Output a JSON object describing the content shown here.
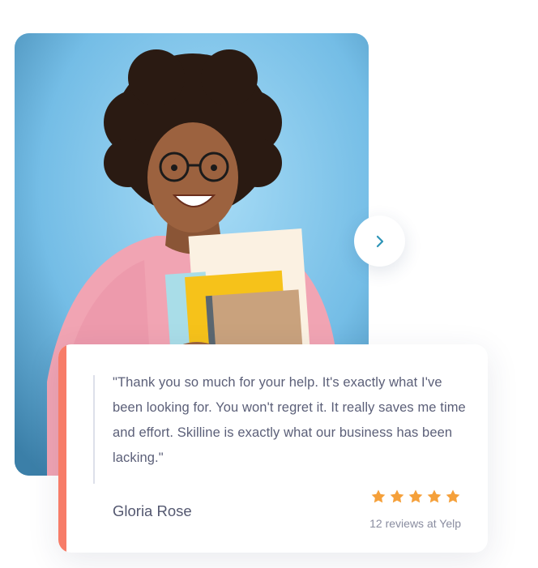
{
  "testimonial": {
    "quote": "\"Thank you so much for your help. It's exactly what I've been looking for. You won't regret it. It really saves me time and effort. Skilline is exactly what our business has been lacking.\"",
    "author": "Gloria Rose",
    "rating": 5,
    "rating_max": 5,
    "reviews_text": "12 reviews at Yelp"
  },
  "navigation": {
    "next_icon": "chevron-right-icon"
  },
  "colors": {
    "accent": "#f77c68",
    "star": "#f5a03a",
    "chevron": "#2f95b8",
    "photo_bg": "#8fd0f2",
    "text": "#5b5f78"
  }
}
